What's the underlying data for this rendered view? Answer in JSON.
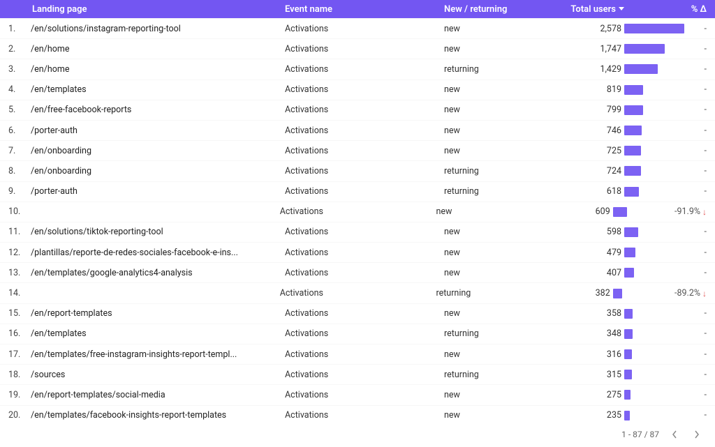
{
  "headers": {
    "landing_page": "Landing page",
    "event_name": "Event name",
    "new_returning": "New / returning",
    "total_users": "Total users",
    "pct_delta": "% Δ"
  },
  "colors": {
    "accent": "#7356f2",
    "bar": "#7c62f3",
    "negative": "#e25353"
  },
  "pagination": {
    "label": "1 - 87 / 87"
  },
  "rows": [
    {
      "idx": "1.",
      "lp": "/en/solutions/instagram-reporting-tool",
      "ev": "Activations",
      "nr": "new",
      "tu": "2,578",
      "tu_num": 2578,
      "pct": "-"
    },
    {
      "idx": "2.",
      "lp": "/en/home",
      "ev": "Activations",
      "nr": "new",
      "tu": "1,747",
      "tu_num": 1747,
      "pct": "-"
    },
    {
      "idx": "3.",
      "lp": "/en/home",
      "ev": "Activations",
      "nr": "returning",
      "tu": "1,429",
      "tu_num": 1429,
      "pct": "-"
    },
    {
      "idx": "4.",
      "lp": "/en/templates",
      "ev": "Activations",
      "nr": "new",
      "tu": "819",
      "tu_num": 819,
      "pct": "-"
    },
    {
      "idx": "5.",
      "lp": "/en/free-facebook-reports",
      "ev": "Activations",
      "nr": "new",
      "tu": "799",
      "tu_num": 799,
      "pct": "-"
    },
    {
      "idx": "6.",
      "lp": "/porter-auth",
      "ev": "Activations",
      "nr": "new",
      "tu": "746",
      "tu_num": 746,
      "pct": "-"
    },
    {
      "idx": "7.",
      "lp": "/en/onboarding",
      "ev": "Activations",
      "nr": "new",
      "tu": "725",
      "tu_num": 725,
      "pct": "-"
    },
    {
      "idx": "8.",
      "lp": "/en/onboarding",
      "ev": "Activations",
      "nr": "returning",
      "tu": "724",
      "tu_num": 724,
      "pct": "-"
    },
    {
      "idx": "9.",
      "lp": "/porter-auth",
      "ev": "Activations",
      "nr": "returning",
      "tu": "618",
      "tu_num": 618,
      "pct": "-"
    },
    {
      "idx": "10.",
      "lp": "",
      "ev": "Activations",
      "nr": "new",
      "tu": "609",
      "tu_num": 609,
      "pct": "-91.9%",
      "neg": true
    },
    {
      "idx": "11.",
      "lp": "/en/solutions/tiktok-reporting-tool",
      "ev": "Activations",
      "nr": "new",
      "tu": "598",
      "tu_num": 598,
      "pct": "-"
    },
    {
      "idx": "12.",
      "lp": "/plantillas/reporte-de-redes-sociales-facebook-e-ins...",
      "ev": "Activations",
      "nr": "new",
      "tu": "479",
      "tu_num": 479,
      "pct": "-"
    },
    {
      "idx": "13.",
      "lp": "/en/templates/google-analytics4-analysis",
      "ev": "Activations",
      "nr": "new",
      "tu": "407",
      "tu_num": 407,
      "pct": "-"
    },
    {
      "idx": "14.",
      "lp": "",
      "ev": "Activations",
      "nr": "returning",
      "tu": "382",
      "tu_num": 382,
      "pct": "-89.2%",
      "neg": true
    },
    {
      "idx": "15.",
      "lp": "/en/report-templates",
      "ev": "Activations",
      "nr": "new",
      "tu": "358",
      "tu_num": 358,
      "pct": "-"
    },
    {
      "idx": "16.",
      "lp": "/en/templates",
      "ev": "Activations",
      "nr": "returning",
      "tu": "348",
      "tu_num": 348,
      "pct": "-"
    },
    {
      "idx": "17.",
      "lp": "/en/templates/free-instagram-insights-report-templ...",
      "ev": "Activations",
      "nr": "new",
      "tu": "316",
      "tu_num": 316,
      "pct": "-"
    },
    {
      "idx": "18.",
      "lp": "/sources",
      "ev": "Activations",
      "nr": "returning",
      "tu": "315",
      "tu_num": 315,
      "pct": "-"
    },
    {
      "idx": "19.",
      "lp": "/en/report-templates/social-media",
      "ev": "Activations",
      "nr": "new",
      "tu": "275",
      "tu_num": 275,
      "pct": "-"
    },
    {
      "idx": "20.",
      "lp": "/en/templates/facebook-insights-report-templates",
      "ev": "Activations",
      "nr": "new",
      "tu": "235",
      "tu_num": 235,
      "pct": "-"
    }
  ],
  "chart_data": {
    "type": "bar",
    "title": "Total users by Landing page / Event / New-returning",
    "xlabel": "",
    "ylabel": "Total users",
    "ylim": [
      0,
      2578
    ],
    "categories": [
      "/en/solutions/instagram-reporting-tool | new",
      "/en/home | new",
      "/en/home | returning",
      "/en/templates | new",
      "/en/free-facebook-reports | new",
      "/porter-auth | new",
      "/en/onboarding | new",
      "/en/onboarding | returning",
      "/porter-auth | returning",
      "(blank) | new",
      "/en/solutions/tiktok-reporting-tool | new",
      "/plantillas/reporte-de-redes-sociales-facebook-e-ins... | new",
      "/en/templates/google-analytics4-analysis | new",
      "(blank) | returning",
      "/en/report-templates | new",
      "/en/templates | returning",
      "/en/templates/free-instagram-insights-report-templ... | new",
      "/sources | returning",
      "/en/report-templates/social-media | new",
      "/en/templates/facebook-insights-report-templates | new"
    ],
    "values": [
      2578,
      1747,
      1429,
      819,
      799,
      746,
      725,
      724,
      618,
      609,
      598,
      479,
      407,
      382,
      358,
      348,
      316,
      315,
      275,
      235
    ]
  }
}
